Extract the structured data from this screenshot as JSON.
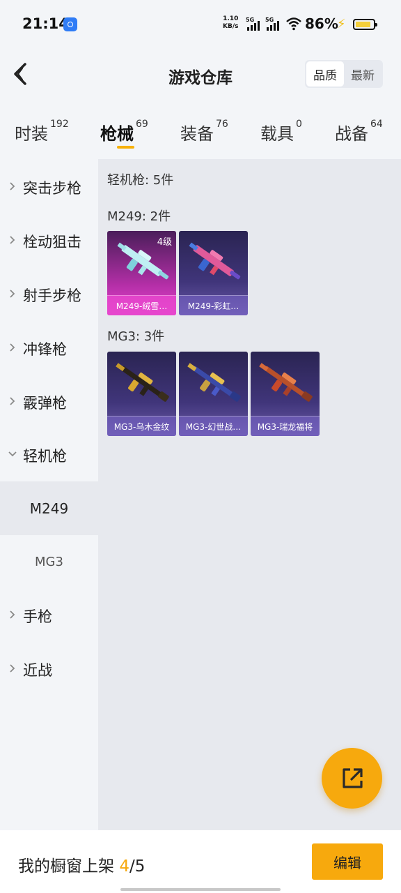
{
  "status": {
    "time": "21:14",
    "net_speed_value": "1.10",
    "net_speed_unit": "KB/s",
    "sim1_label": "5G",
    "sim2_label": "5G",
    "battery_percent": "86%",
    "battery_level": 0.86,
    "icons": [
      "hotspot-icon",
      "signal-icon",
      "wifi-icon",
      "charging-icon",
      "battery-icon"
    ]
  },
  "header": {
    "title": "游戏仓库",
    "back_icon": "chevron-left-icon",
    "sort_options": [
      "品质",
      "最新"
    ],
    "sort_selected": "品质"
  },
  "category_tabs": [
    {
      "label": "时装",
      "count": "192"
    },
    {
      "label": "枪械",
      "count": "69"
    },
    {
      "label": "装备",
      "count": "76"
    },
    {
      "label": "载具",
      "count": "0"
    },
    {
      "label": "战备",
      "count": "64"
    }
  ],
  "active_tab": "枪械",
  "accent_color": "#f7a90d",
  "sidebar": {
    "items": [
      {
        "label": "突击步枪"
      },
      {
        "label": "栓动狙击"
      },
      {
        "label": "射手步枪"
      },
      {
        "label": "冲锋枪"
      },
      {
        "label": "霰弹枪"
      },
      {
        "label": "轻机枪"
      },
      {
        "label": "手枪"
      },
      {
        "label": "近战"
      }
    ],
    "expanded": "轻机枪",
    "subitems": [
      {
        "label": "M249"
      },
      {
        "label": "MG3"
      }
    ],
    "selected_subitem": "M249"
  },
  "content": {
    "summary": "轻机枪: 5件",
    "groups": [
      {
        "title": "M249: 2件",
        "items": [
          {
            "name": "M249-绒雪…",
            "level": "4级",
            "rarity_color": "#e846d0"
          },
          {
            "name": "M249-彩虹…",
            "level": "",
            "rarity_color": "#6a5aa8"
          }
        ]
      },
      {
        "title": "MG3: 3件",
        "items": [
          {
            "name": "MG3-乌木金纹",
            "level": "",
            "rarity_color": "#6a5aa8"
          },
          {
            "name": "MG3-幻世战…",
            "level": "",
            "rarity_color": "#6a5aa8"
          },
          {
            "name": "MG3-瑞龙福将",
            "level": "",
            "rarity_color": "#6a5aa8"
          }
        ]
      }
    ]
  },
  "fab": {
    "icon": "share-external-icon"
  },
  "bottom": {
    "label_prefix": "我的橱窗上架",
    "shelf_count": "4",
    "shelf_total": "/5",
    "edit_label": "编辑"
  }
}
